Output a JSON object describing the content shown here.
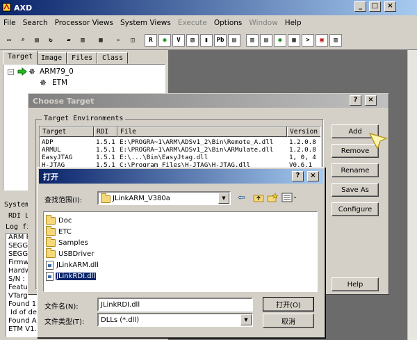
{
  "app": {
    "title": "AXD",
    "menu": [
      {
        "label": "File",
        "disabled": false
      },
      {
        "label": "Search",
        "disabled": false
      },
      {
        "label": "Processor Views",
        "disabled": false
      },
      {
        "label": "System Views",
        "disabled": false
      },
      {
        "label": "Execute",
        "disabled": true
      },
      {
        "label": "Options",
        "disabled": false
      },
      {
        "label": "Window",
        "disabled": true
      },
      {
        "label": "Help",
        "disabled": false
      }
    ],
    "caption_buttons": {
      "minimize": "_",
      "maximize": "□",
      "close": "×"
    }
  },
  "left_panel": {
    "tabs": [
      "Target",
      "Image",
      "Files",
      "Class"
    ],
    "tree": {
      "root": "ARM79_0",
      "child": "ETM"
    }
  },
  "status_panel": {
    "label_system": "System",
    "label_rdi": "RDI L",
    "label_log": "Log fi",
    "log_lines": [
      "ARM R",
      "SEGG",
      "SEGG",
      "Firmw",
      "Hardw",
      "S/N :",
      "Featur",
      "VTarg",
      "Found 1",
      " Id of dev",
      "Found AF",
      "ETM V1."
    ]
  },
  "choose_target": {
    "title": "Choose Target",
    "group_label": "Target Environments",
    "columns": [
      "Target",
      "RDI",
      "File",
      "Version"
    ],
    "rows": [
      {
        "target": "ADP",
        "rdi": "1.5.1",
        "file": "E:\\PROGRA~1\\ARM\\ADSv1_2\\Bin\\Remote_A.dll",
        "version": "1.2.0.8"
      },
      {
        "target": "ARMUL",
        "rdi": "1.5.1",
        "file": "E:\\PROGRA~1\\ARM\\ADSv1_2\\Bin\\ARMulate.dll",
        "version": "1.2.0.8"
      },
      {
        "target": "EasyJTAG",
        "rdi": "1.5.1",
        "file": "E:\\...\\Bin\\EasyJtag.dll",
        "version": "1, 0, 4"
      },
      {
        "target": "H-JTAG",
        "rdi": "1.5.1",
        "file": "C:\\Program Files\\H-JTAG\\H-JTAG.dll",
        "version": "V0.6.1"
      }
    ],
    "buttons": {
      "add": "Add",
      "remove": "Remove",
      "rename": "Rename",
      "save_as": "Save As",
      "configure": "Configure",
      "help": "Help"
    },
    "help_glyph": "?",
    "close_glyph": "×"
  },
  "open_dialog": {
    "title": "打开",
    "look_in_label": "查找范围(I):",
    "look_in_value": "JLinkARM_V380a",
    "files": [
      {
        "name": "Doc",
        "kind": "folder"
      },
      {
        "name": "ETC",
        "kind": "folder"
      },
      {
        "name": "Samples",
        "kind": "folder"
      },
      {
        "name": "USBDriver",
        "kind": "folder"
      },
      {
        "name": "JLinkARM.dll",
        "kind": "dll"
      },
      {
        "name": "JLinkRDI.dll",
        "kind": "dll",
        "selected": true
      }
    ],
    "filename_label": "文件名(N):",
    "filename_value": "JLinkRDI.dll",
    "filetype_label": "文件类型(T):",
    "filetype_value": "DLLs (*.dll)",
    "open_button": "打开(O)",
    "cancel_button": "取消",
    "help_glyph": "?",
    "close_glyph": "×"
  },
  "colors": {
    "title_active": "#0a246a",
    "title_inactive": "#808080",
    "face": "#d4d0c8",
    "workspace": "#6b6b6b",
    "selection": "#0a246a"
  }
}
